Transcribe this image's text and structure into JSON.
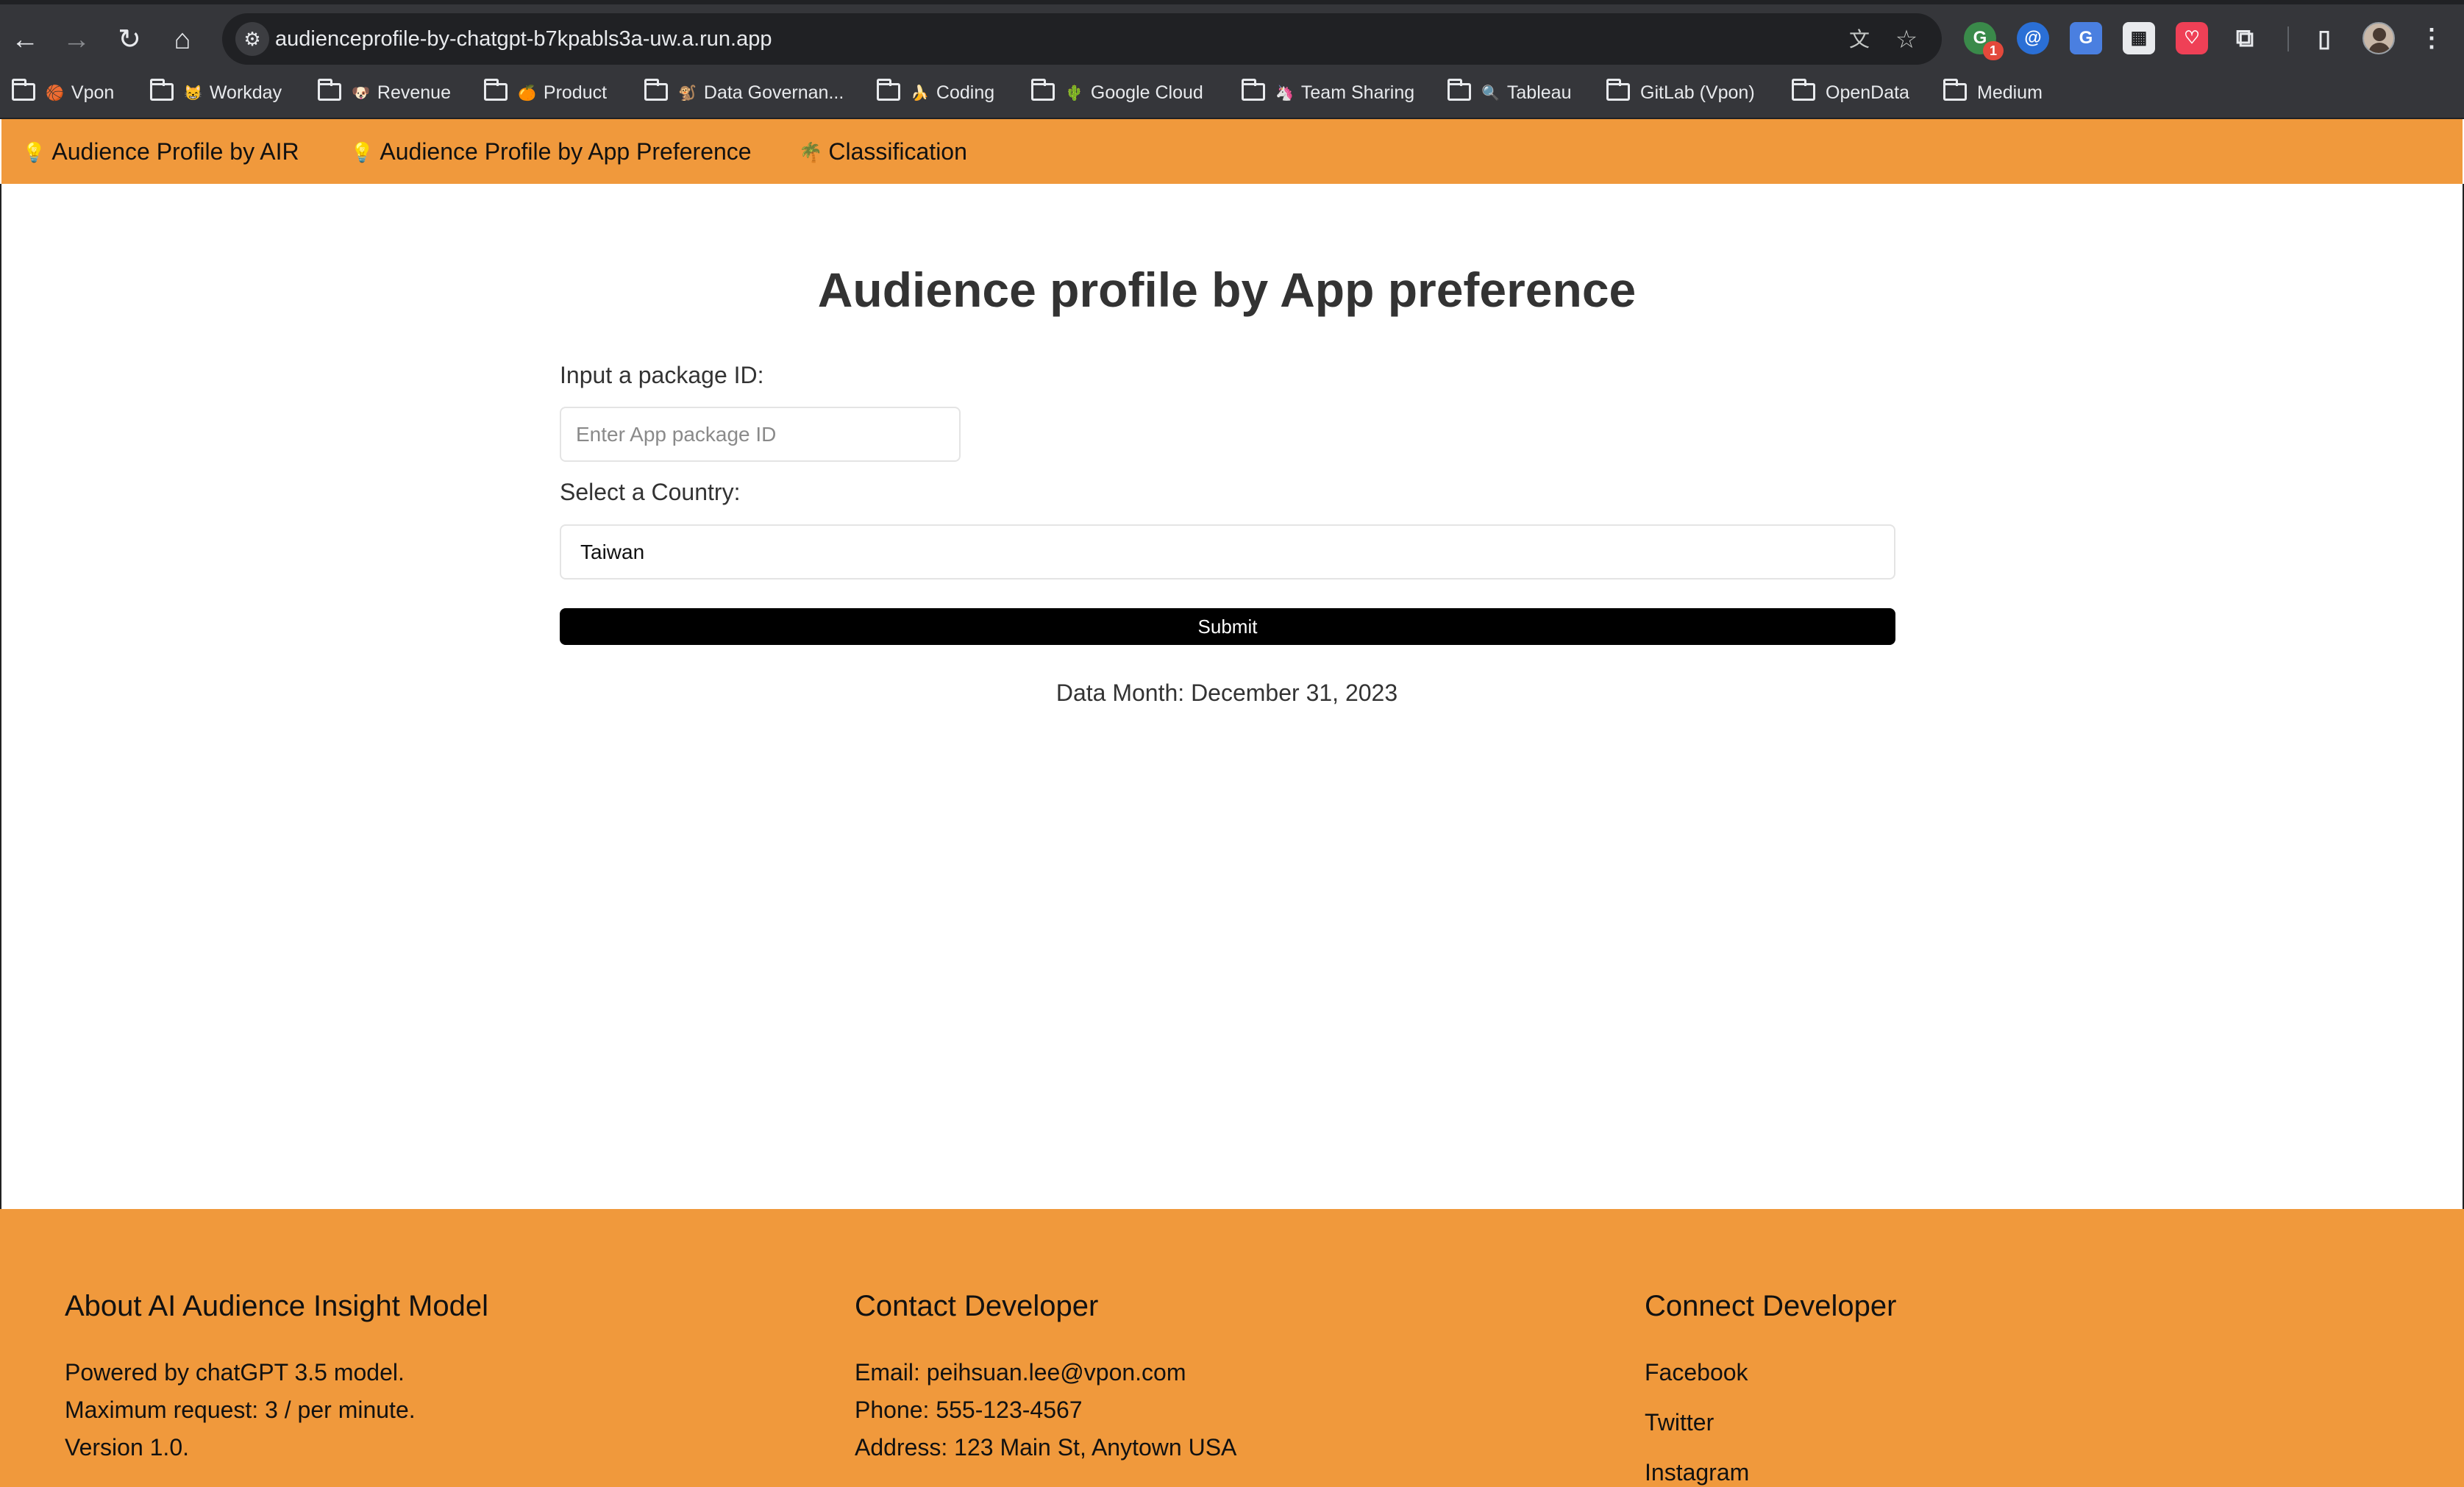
{
  "browser": {
    "url": "audienceprofile-by-chatgpt-b7kpabls3a-uw.a.run.app",
    "extension_badge": "1",
    "bookmarks": [
      {
        "label": "Vpon",
        "emoji": "🏀"
      },
      {
        "label": "Workday",
        "emoji": "😸"
      },
      {
        "label": "Revenue",
        "emoji": "🐶"
      },
      {
        "label": "Product",
        "emoji": "🍊"
      },
      {
        "label": "Data Governan...",
        "emoji": "🐒"
      },
      {
        "label": "Coding",
        "emoji": "🍌"
      },
      {
        "label": "Google Cloud",
        "emoji": "🌵"
      },
      {
        "label": "Team Sharing",
        "emoji": "🦄"
      },
      {
        "label": "Tableau",
        "emoji": "🔍"
      },
      {
        "label": "GitLab (Vpon)",
        "emoji": ""
      },
      {
        "label": "OpenData",
        "emoji": ""
      },
      {
        "label": "Medium",
        "emoji": ""
      }
    ]
  },
  "app_nav": {
    "items": [
      {
        "label": "Audience Profile by AIR",
        "icon": "💡"
      },
      {
        "label": "Audience Profile by App Preference",
        "icon": "💡"
      },
      {
        "label": "Classification",
        "icon": "🌴"
      }
    ]
  },
  "main": {
    "title": "Audience profile by App preference",
    "package_label": "Input a package ID:",
    "package_placeholder": "Enter App package ID",
    "package_value": "",
    "country_label": "Select a Country:",
    "country_value": "Taiwan",
    "submit_label": "Submit",
    "data_month": "Data Month: December 31, 2023"
  },
  "footer": {
    "about": {
      "heading": "About AI Audience Insight Model",
      "lines": [
        "Powered by chatGPT 3.5 model.",
        "Maximum request: 3 / per minute.",
        "Version 1.0."
      ]
    },
    "contact": {
      "heading": "Contact Developer",
      "lines": [
        "Email: peihsuan.lee@vpon.com",
        "Phone: 555-123-4567",
        "Address: 123 Main St, Anytown USA"
      ]
    },
    "connect": {
      "heading": "Connect Developer",
      "links": [
        "Facebook",
        "Twitter",
        "Instagram"
      ]
    }
  },
  "colors": {
    "accent": "#f0993c",
    "chrome": "#35363a",
    "button": "#000000"
  }
}
